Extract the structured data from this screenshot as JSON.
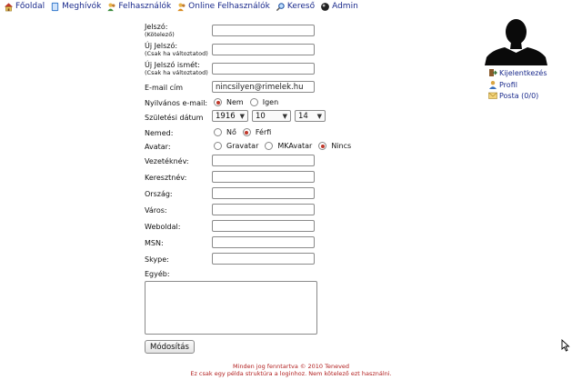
{
  "nav": {
    "items": [
      {
        "label": "Főoldal",
        "icon": "home-icon"
      },
      {
        "label": "Meghívók",
        "icon": "book-icon"
      },
      {
        "label": "Felhasználók",
        "icon": "users-icon"
      },
      {
        "label": "Online Felhasználók",
        "icon": "users-online-icon"
      },
      {
        "label": "Kereső",
        "icon": "search-icon"
      },
      {
        "label": "Admin",
        "icon": "admin-icon"
      }
    ]
  },
  "form": {
    "password_label": "Jelszó:",
    "password_note": "(Kötelező)",
    "new_password_label": "Új Jelszó:",
    "new_password_note": "(Csak ha változtatod)",
    "new_password_again_label": "Új Jelszó ismét:",
    "new_password_again_note": "(Csak ha változtatod)",
    "email_label": "E-mail cím",
    "email_value": "nincsilyen@rimelek.hu",
    "public_email_label": "Nyilvános e-mail:",
    "public_email_options": [
      "Nem",
      "Igen"
    ],
    "public_email_selected": "Nem",
    "birth_label": "Születési dátum",
    "birth_year": "1916",
    "birth_month": "10",
    "birth_day": "14",
    "gender_label": "Nemed:",
    "gender_options": [
      "Nő",
      "Férfi"
    ],
    "gender_selected": "Férfi",
    "avatar_label": "Avatar:",
    "avatar_options": [
      "Gravatar",
      "MKAvatar",
      "Nincs"
    ],
    "avatar_selected": "Nincs",
    "lastname_label": "Vezetéknév:",
    "firstname_label": "Keresztnév:",
    "country_label": "Ország:",
    "city_label": "Város:",
    "website_label": "Weboldal:",
    "msn_label": "MSN:",
    "skype_label": "Skype:",
    "other_label": "Egyéb:",
    "submit_label": "Módosítás"
  },
  "sidebar": {
    "logout": "Kijelentkezés",
    "profile": "Profil",
    "mail": "Posta (0/0)"
  },
  "footer": {
    "line1": "Minden jog fenntartva © 2010 Teneved",
    "line2": "Ez csak egy példa struktúra a loginhoz. Nem kötelező ezt használni."
  },
  "colors": {
    "link": "#1a2a8c",
    "footer": "#b22020",
    "radio_on": "#c0392b"
  }
}
